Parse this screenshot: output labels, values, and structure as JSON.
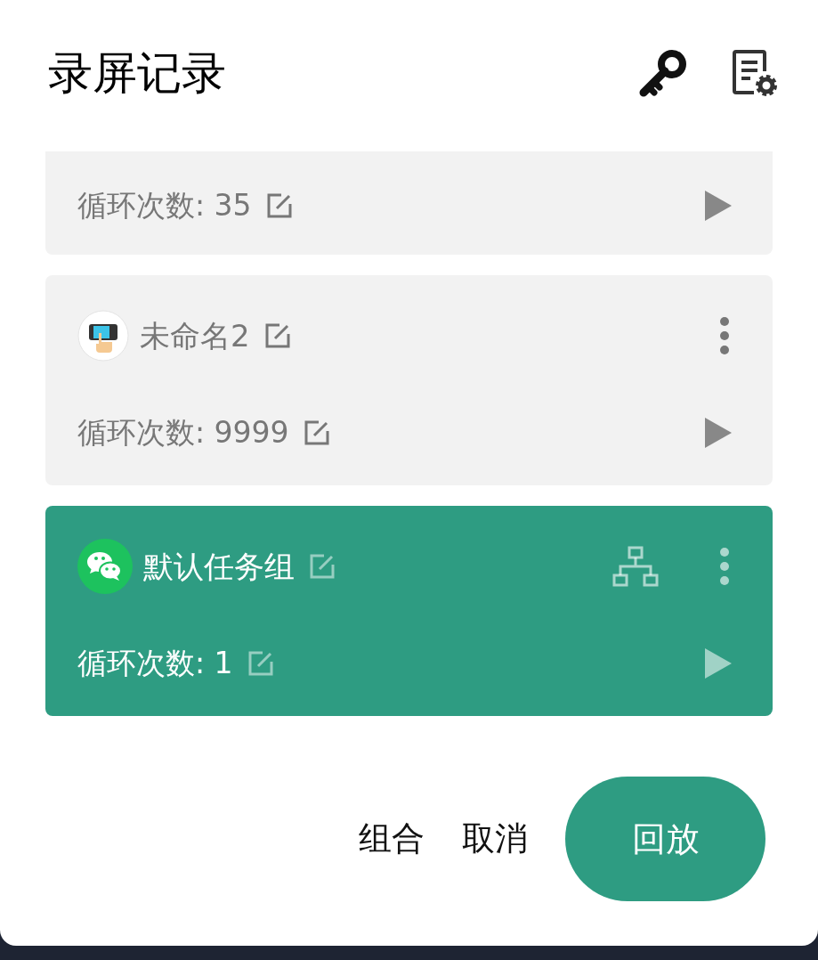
{
  "title": "录屏记录",
  "records": [
    {
      "loop": "循环次数: 35",
      "selected": false
    },
    {
      "name": "未命名2",
      "kind": "tap",
      "grouped": false,
      "loop": "循环次数: 9999",
      "selected": false
    },
    {
      "name": "默认任务组",
      "kind": "chat",
      "grouped": true,
      "loop": "循环次数: 1",
      "selected": true
    }
  ],
  "buttons": [
    {
      "label": "组合",
      "kind": "text"
    },
    {
      "label": "取消",
      "kind": "text"
    },
    {
      "label": "回放",
      "kind": "primary"
    }
  ]
}
